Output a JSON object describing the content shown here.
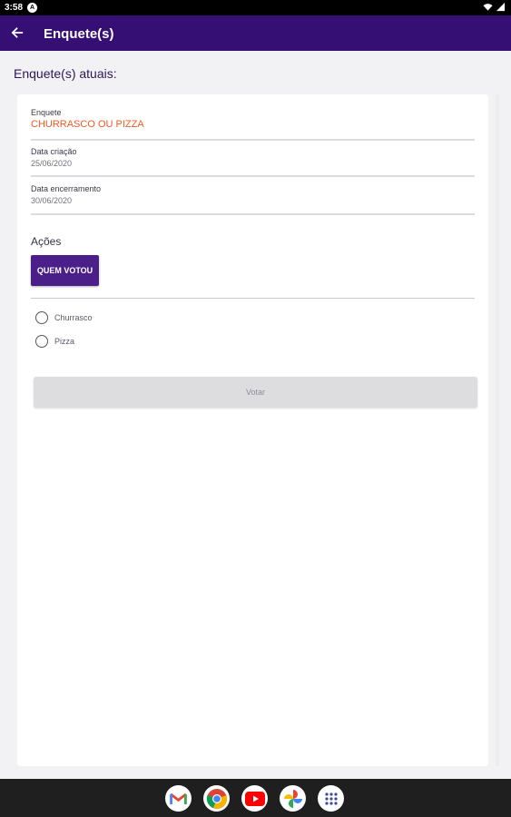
{
  "status_bar": {
    "time": "3:58",
    "notification_icon": "a-circle-icon"
  },
  "app_bar": {
    "title": "Enquete(s)",
    "back_icon": "arrow-left-icon"
  },
  "section_heading": "Enquete(s) atuais:",
  "poll": {
    "fields": [
      {
        "label": "Enquete",
        "value": "CHURRASCO OU PIZZA"
      },
      {
        "label": "Data criação",
        "value": "25/06/2020"
      },
      {
        "label": "Data encerramento",
        "value": "30/06/2020"
      }
    ],
    "acoes_title": "Ações",
    "quem_votou_label": "QUEM VOTOU",
    "options": [
      {
        "label": "Churrasco",
        "selected": false
      },
      {
        "label": "Pizza",
        "selected": false
      }
    ],
    "votar_label": "Votar"
  },
  "colors": {
    "app_bar": "#360f74",
    "accent": "#ef5a24",
    "button": "#4a1f8a"
  },
  "dock": [
    "gmail-icon",
    "chrome-icon",
    "youtube-icon",
    "photos-icon",
    "app-drawer-icon"
  ]
}
